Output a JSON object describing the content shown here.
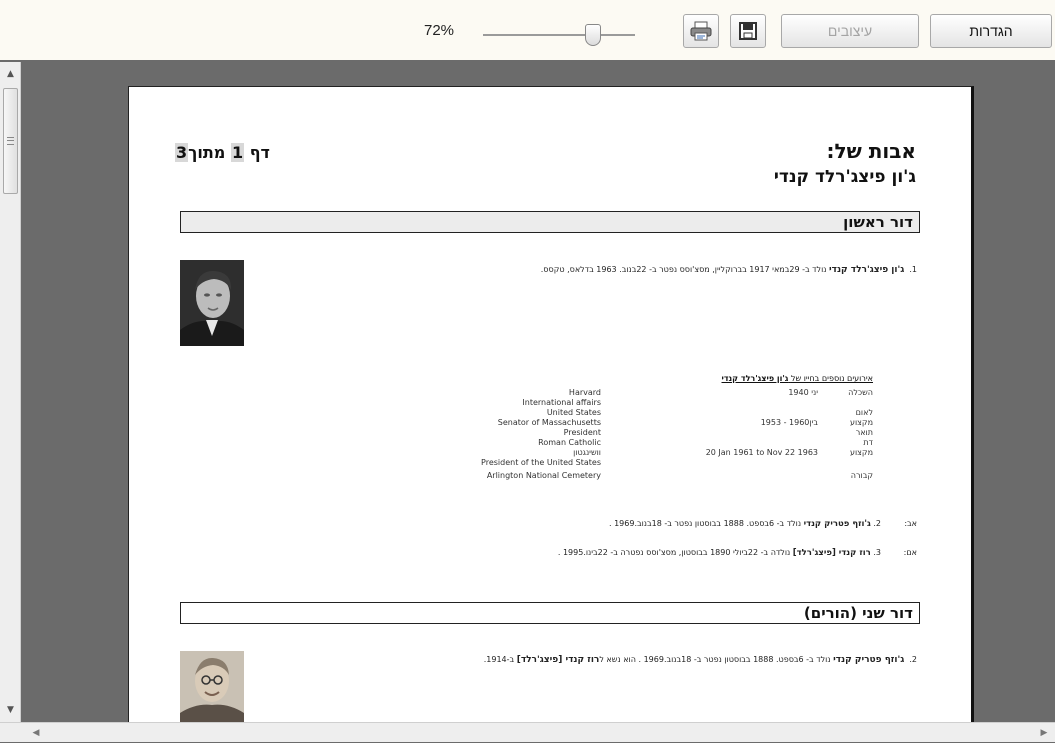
{
  "toolbar": {
    "zoom_label": "72%",
    "styles_label": "עיצובים",
    "settings_label": "הגדרות",
    "print_icon": "print-icon",
    "save_icon": "save-icon"
  },
  "header": {
    "title": "אבות של:",
    "subject": "ג'ון פיצג'רלד קנדי",
    "page_prefix": "דף",
    "page_current": "1",
    "page_middle": "מתוך",
    "page_total": "3"
  },
  "gen1": {
    "label": "דור ראשון"
  },
  "gen2": {
    "label": "דור שני (הורים)"
  },
  "person1": {
    "num": "1.",
    "name": "ג'ון פיצג'רלד קנדי",
    "details": "נולד ב- 29במאי 1917 בברוקליין, מסצ'וסס נפטר ב- 22בנוב. 1963 בדלאס, טקסס."
  },
  "events": {
    "head_prefix": "אירועים נוספים בחייו של",
    "head_name": "ג'ון פיצג'רלד קנדי",
    "rows": [
      {
        "type": "השכלה",
        "date": "1940 יני",
        "value": "Harvard"
      },
      {
        "type": "",
        "date": "",
        "value": "International affairs"
      },
      {
        "type": "לאום",
        "date": "",
        "value": "United States"
      },
      {
        "type": "מקצוע",
        "date": "1953 - 1960בין",
        "value": "Senator of Massachusetts"
      },
      {
        "type": "תואר",
        "date": "",
        "value": "President"
      },
      {
        "type": "דת",
        "date": "",
        "value": "Roman Catholic"
      },
      {
        "type": "מקצוע",
        "date": "20 Jan 1961 to Nov 22 1963",
        "value": "וושינגטון"
      },
      {
        "type": "",
        "date": "",
        "value": "President of the United States"
      },
      {
        "type": "קבורה",
        "date": "",
        "value": "Arlington National Cemetery"
      }
    ]
  },
  "father": {
    "role": "אב:",
    "num": "2.",
    "name": "ג'וזף פטריק קנדי",
    "details": "נולד ב- 6בספט. 1888 בבוסטון נפטר ב- 18בנוב.1969 ."
  },
  "mother": {
    "role": "אם:",
    "num": "3.",
    "name": "רוז קנדי [פיצג'רלד]",
    "details": "נולדה ב- 22ביולי 1890 בבוסטון, מסצ'וסס נפטרה ב- 22בינו.1995 ."
  },
  "person2": {
    "num": "2.",
    "name": "ג'וזף פטריק קנדי",
    "details": "נולד ב- 6בספט. 1888 בבוסטון נפטר ב- 18בנוב.1969 . הוא נשא ל",
    "spouse": "רוז קנדי [פיצג'רלד]",
    "tail": "ב-1914."
  }
}
